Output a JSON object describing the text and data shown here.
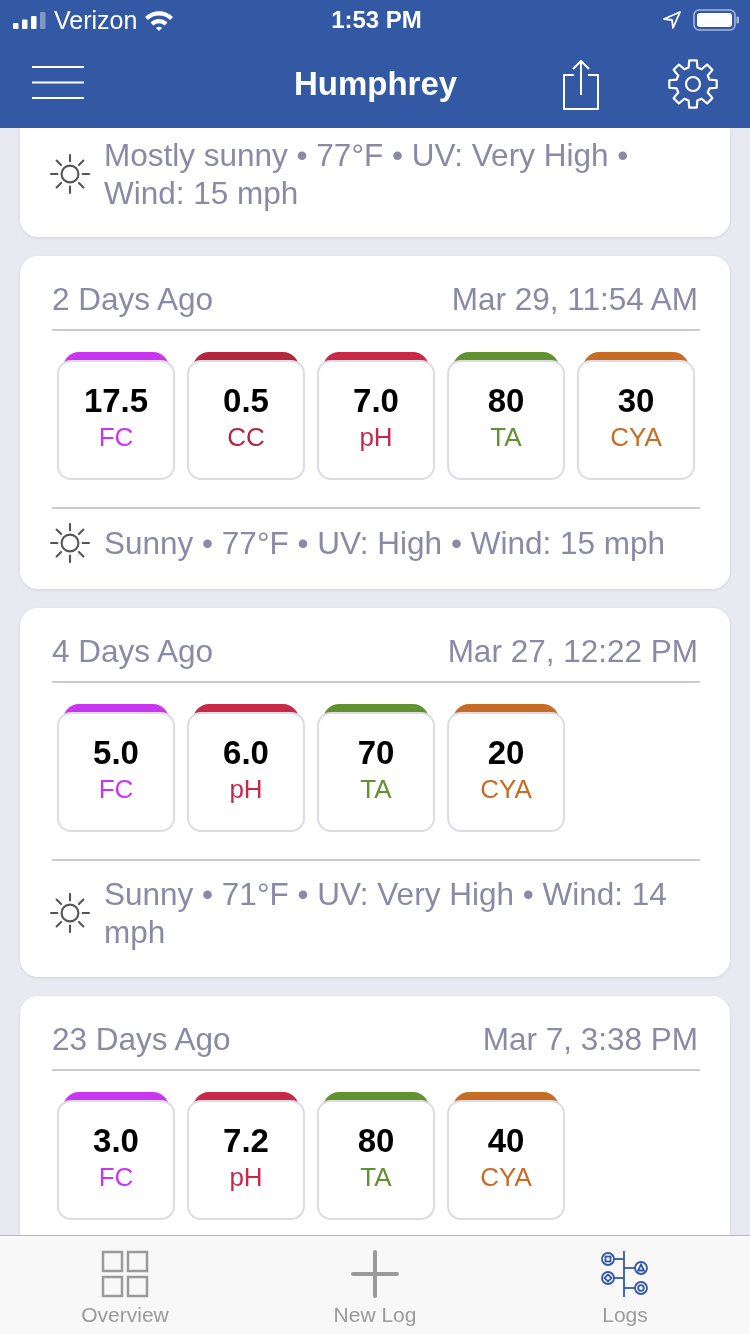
{
  "status_bar": {
    "carrier": "Verizon",
    "time": "1:53 PM"
  },
  "nav_bar": {
    "title": "Humphrey"
  },
  "cards": [
    {
      "weather": "Mostly sunny • 77°F • UV: Very High • Wind: 15 mph"
    },
    {
      "age": "2 Days Ago",
      "date": "Mar 29, 11:54 AM",
      "readings": [
        {
          "value": "17.5",
          "label": "FC",
          "color": "#c935f2"
        },
        {
          "value": "0.5",
          "label": "CC",
          "color": "#b3263e"
        },
        {
          "value": "7.0",
          "label": "pH",
          "color": "#c92848"
        },
        {
          "value": "80",
          "label": "TA",
          "color": "#62912f"
        },
        {
          "value": "30",
          "label": "CYA",
          "color": "#c86b24"
        }
      ],
      "weather": "Sunny • 77°F • UV: High • Wind: 15 mph"
    },
    {
      "age": "4 Days Ago",
      "date": "Mar 27, 12:22 PM",
      "readings": [
        {
          "value": "5.0",
          "label": "FC",
          "color": "#c935f2"
        },
        {
          "value": "6.0",
          "label": "pH",
          "color": "#c92848"
        },
        {
          "value": "70",
          "label": "TA",
          "color": "#62912f"
        },
        {
          "value": "20",
          "label": "CYA",
          "color": "#c86b24"
        }
      ],
      "weather": "Sunny • 71°F • UV: Very High • Wind: 14 mph"
    },
    {
      "age": "23 Days Ago",
      "date": "Mar 7, 3:38 PM",
      "readings": [
        {
          "value": "3.0",
          "label": "FC",
          "color": "#c935f2"
        },
        {
          "value": "7.2",
          "label": "pH",
          "color": "#c92848"
        },
        {
          "value": "80",
          "label": "TA",
          "color": "#62912f"
        },
        {
          "value": "40",
          "label": "CYA",
          "color": "#c86b24"
        }
      ]
    }
  ],
  "tab_bar": {
    "tabs": [
      {
        "label": "Overview",
        "selected": false
      },
      {
        "label": "New Log",
        "selected": false
      },
      {
        "label": "Logs",
        "selected": true
      }
    ]
  }
}
